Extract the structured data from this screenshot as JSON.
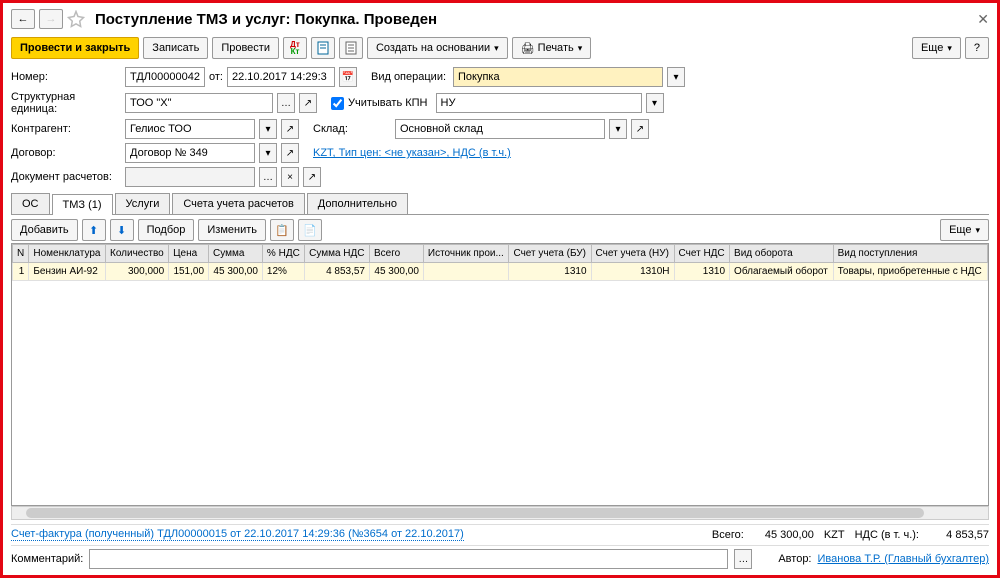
{
  "title": "Поступление ТМЗ и услуг: Покупка. Проведен",
  "toolbar": {
    "post_close": "Провести и закрыть",
    "save": "Записать",
    "post": "Провести",
    "create_basis": "Создать на основании",
    "print": "Печать",
    "more": "Еще",
    "help": "?"
  },
  "form": {
    "number_lbl": "Номер:",
    "number_val": "ТДЛ00000042",
    "from_lbl": "от:",
    "date_val": "22.10.2017 14:29:3",
    "struct_lbl": "Структурная единица:",
    "struct_val": "ТОО \"X\"",
    "contr_lbl": "Контрагент:",
    "contr_val": "Гелиос ТОО",
    "dogovor_lbl": "Договор:",
    "dogovor_val": "Договор № 349",
    "docrasch_lbl": "Документ расчетов:",
    "vid_op_lbl": "Вид операции:",
    "vid_op_val": "Покупка",
    "uchit_kpn_lbl": "Учитывать КПН",
    "kpn_val": "НУ",
    "sklad_lbl": "Склад:",
    "sklad_val": "Основной склад",
    "price_info": "KZT, Тип цен: <не указан>, НДС (в т.ч.)"
  },
  "tabs": {
    "os": "ОС",
    "tmz": "ТМЗ (1)",
    "uslugi": "Услуги",
    "schet": "Счета учета расчетов",
    "dop": "Дополнительно"
  },
  "grid_toolbar": {
    "add": "Добавить",
    "pick": "Подбор",
    "edit": "Изменить",
    "more": "Еще"
  },
  "grid": {
    "headers": [
      "N",
      "Номенклатура",
      "Количество",
      "Цена",
      "Сумма",
      "% НДС",
      "Сумма НДС",
      "Всего",
      "Источник прои...",
      "Счет учета (БУ)",
      "Счет учета (НУ)",
      "Счет НДС",
      "Вид оборота",
      "Вид поступления"
    ],
    "rows": [
      {
        "n": "1",
        "nom": "Бензин АИ-92",
        "qty": "300,000",
        "price": "151,00",
        "sum": "45 300,00",
        "nds_pct": "12%",
        "nds_sum": "4 853,57",
        "total": "45 300,00",
        "src": "",
        "bu": "1310",
        "nu": "1310Н",
        "nds_acc": "1310",
        "oborot": "Облагаемый оборот",
        "post": "Товары, приобретенные с НДС"
      }
    ]
  },
  "footer": {
    "sf_link": "Счет-фактура (полученный) ТДЛ00000015 от 22.10.2017 14:29:36 (№3654 от 22.10.2017)",
    "total_lbl": "Всего:",
    "total_val": "45 300,00",
    "currency": "KZT",
    "nds_lbl": "НДС (в т. ч.):",
    "nds_val": "4 853,57",
    "comment_lbl": "Комментарий:",
    "author_lbl": "Автор:",
    "author_val": "Иванова Т.Р. (Главный бухгалтер)"
  }
}
